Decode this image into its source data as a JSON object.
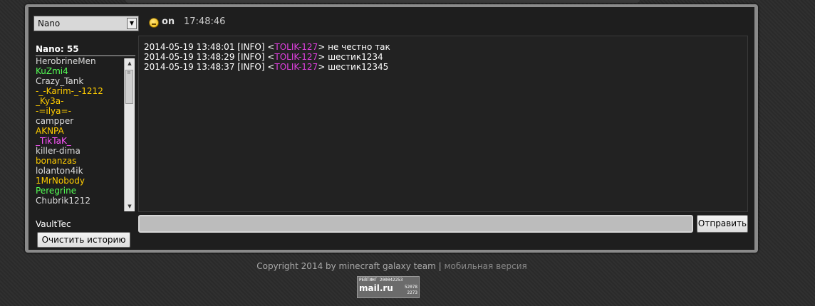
{
  "server_select": {
    "value": "Nano"
  },
  "status": {
    "text": "on",
    "time": "17:48:46"
  },
  "online": {
    "label": "Nano: 55"
  },
  "players": [
    {
      "name": "HerobrineMen",
      "color": "#dddddd"
    },
    {
      "name": "KuZmi4",
      "color": "#55ff55"
    },
    {
      "name": "Crazy_Tank",
      "color": "#dddddd"
    },
    {
      "name": "-_-Karim-_-1212",
      "color": "#ffcc00"
    },
    {
      "name": "_Ky3a-",
      "color": "#ffcc00"
    },
    {
      "name": "-=ilya=-",
      "color": "#ffcc00"
    },
    {
      "name": "campper",
      "color": "#dddddd"
    },
    {
      "name": "AKNPA",
      "color": "#ffcc00"
    },
    {
      "name": "_TikTaK_",
      "color": "#ff55ff"
    },
    {
      "name": "killer-dima",
      "color": "#dddddd"
    },
    {
      "name": "bonanzas",
      "color": "#ffcc00"
    },
    {
      "name": "lolanton4ik",
      "color": "#dddddd"
    },
    {
      "name": "1MrNobody",
      "color": "#ffcc00"
    },
    {
      "name": "Peregrine",
      "color": "#55ff55"
    },
    {
      "name": "Chubrik1212",
      "color": "#dddddd"
    }
  ],
  "messages": [
    {
      "prefix": "2014-05-19 13:48:01 [INFO] <",
      "nick": "TOLIK-127",
      "text": "> не честно так"
    },
    {
      "prefix": "2014-05-19 13:48:29 [INFO] <",
      "nick": "TOLIK-127",
      "text": "> шестик1234"
    },
    {
      "prefix": "2014-05-19 13:48:37 [INFO] <",
      "nick": "TOLIK-127",
      "text": "> шестик12345"
    }
  ],
  "current_user": "VaultTec",
  "buttons": {
    "clear_history": "Очистить историю",
    "send": "Отправить"
  },
  "input": {
    "value": ""
  },
  "footer": {
    "copyright": "Copyright 2014 by minecraft galaxy team",
    "separator": "|",
    "mobile_link": "мобильная версия"
  },
  "counter": {
    "title": "РЕЙТИНГ 200042253",
    "logo": "mail.ru",
    "n1": "52078",
    "n2": "2273"
  }
}
